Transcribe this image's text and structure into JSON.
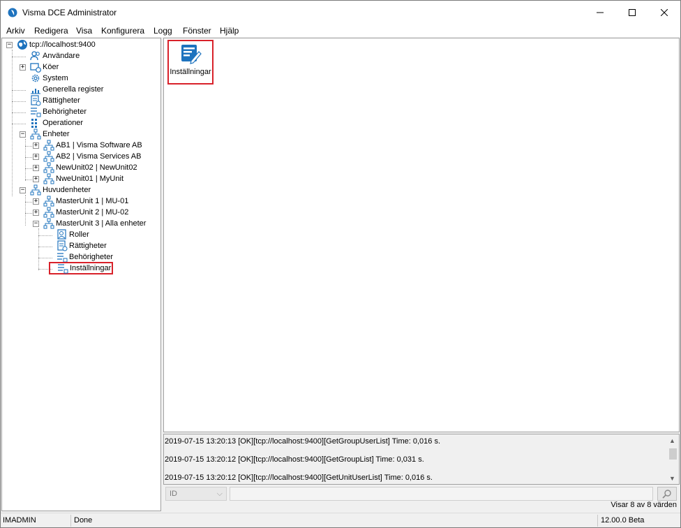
{
  "window": {
    "title": "Visma DCE Administrator"
  },
  "menu": [
    "Arkiv",
    "Redigera",
    "Visa",
    "Konfigurera",
    "Logg",
    "Fönster",
    "Hjälp"
  ],
  "tree": {
    "root": "tcp://localhost:9400",
    "items": [
      "Användare",
      "Köer",
      "System",
      "Generella register",
      "Rättigheter",
      "Behörigheter",
      "Operationer",
      "Enheter",
      "AB1 | Visma Software AB",
      "AB2 | Visma Services AB",
      "NewUnit02 | NewUnit02",
      "NweUnit01 | MyUnit",
      "Huvudenheter",
      "MasterUnit 1 | MU-01",
      "MasterUnit 2 | MU-02",
      "MasterUnit 3 | Alla enheter",
      "Roller",
      "Rättigheter",
      "Behörigheter",
      "Inställningar"
    ]
  },
  "content": {
    "settings_tile_label": "Inställningar"
  },
  "log": {
    "lines": [
      "2019-07-15 13:20:13 [OK][tcp://localhost:9400][GetGroupUserList]  Time: 0,016 s.",
      "2019-07-15 13:20:12 [OK][tcp://localhost:9400][GetGroupList]  Time: 0,031 s.",
      "2019-07-15 13:20:12 [OK][tcp://localhost:9400][GetUnitUserList]  Time: 0,016 s."
    ]
  },
  "filter": {
    "field_value": "ID",
    "count_text": "Visar 8 av 8 värden"
  },
  "status": {
    "user": "IMADMIN",
    "state": "Done",
    "version": "12.00.0 Beta"
  },
  "colors": {
    "highlight": "#d8212a",
    "icon_blue": "#1e73be"
  }
}
